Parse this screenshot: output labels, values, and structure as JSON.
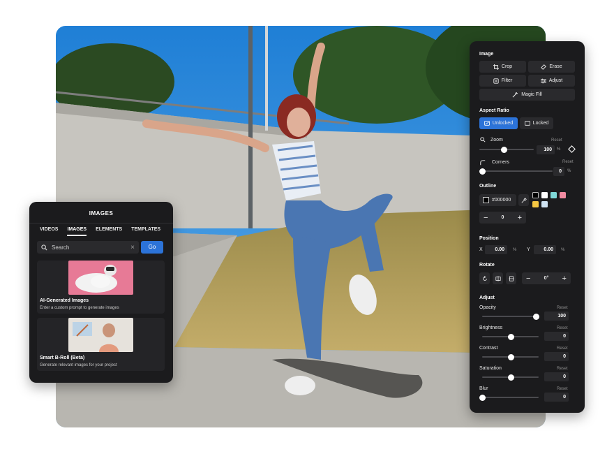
{
  "images_panel": {
    "title": "IMAGES",
    "tabs": [
      "VIDEOS",
      "IMAGES",
      "ELEMENTS",
      "TEMPLATES"
    ],
    "active_tab": "IMAGES",
    "search_placeholder": "Search",
    "go_label": "Go",
    "cards": [
      {
        "title": "AI-Generated Images",
        "subtitle": "Enter a custom prompt to generate images"
      },
      {
        "title": "Smart B-Roll (Beta)",
        "subtitle": "Generate relevant images for your project"
      }
    ]
  },
  "edit_panel": {
    "image_section": "Image",
    "buttons": {
      "crop": "Crop",
      "erase": "Erase",
      "filter": "Filter",
      "adjust": "Adjust",
      "magic_fill": "Magic Fill"
    },
    "aspect_ratio": {
      "label": "Aspect Ratio",
      "unlocked": "Unlocked",
      "locked": "Locked",
      "selected": "Unlocked"
    },
    "zoom": {
      "label": "Zoom",
      "reset": "Reset",
      "value": "100",
      "unit": "%",
      "fraction": 0.45
    },
    "corners": {
      "label": "Corners",
      "reset": "Reset",
      "value": "0",
      "unit": "%",
      "fraction": 0.0
    },
    "outline": {
      "label": "Outline",
      "color": "#000000",
      "width": "0",
      "swatches": [
        "#000000",
        "#ffffff",
        "#7fd8d8",
        "#f08aa0",
        "#f5c742",
        "#cfe3f2"
      ]
    },
    "position": {
      "label": "Position",
      "x_label": "X",
      "x_value": "0.00",
      "y_label": "Y",
      "y_value": "0.00",
      "unit": "%"
    },
    "rotate": {
      "label": "Rotate",
      "value": "0°"
    },
    "adjust": {
      "label": "Adjust",
      "reset": "Reset",
      "sliders": [
        {
          "label": "Opacity",
          "value": "100",
          "fraction": 1.0
        },
        {
          "label": "Brightness",
          "value": "0",
          "fraction": 0.5
        },
        {
          "label": "Contrast",
          "value": "0",
          "fraction": 0.5
        },
        {
          "label": "Saturation",
          "value": "0",
          "fraction": 0.5
        },
        {
          "label": "Blur",
          "value": "0",
          "fraction": 0.0
        }
      ]
    }
  },
  "colors": {
    "accent": "#2c73d8",
    "panel_bg": "#1b1b1d",
    "control_bg": "#2a2a2d"
  }
}
